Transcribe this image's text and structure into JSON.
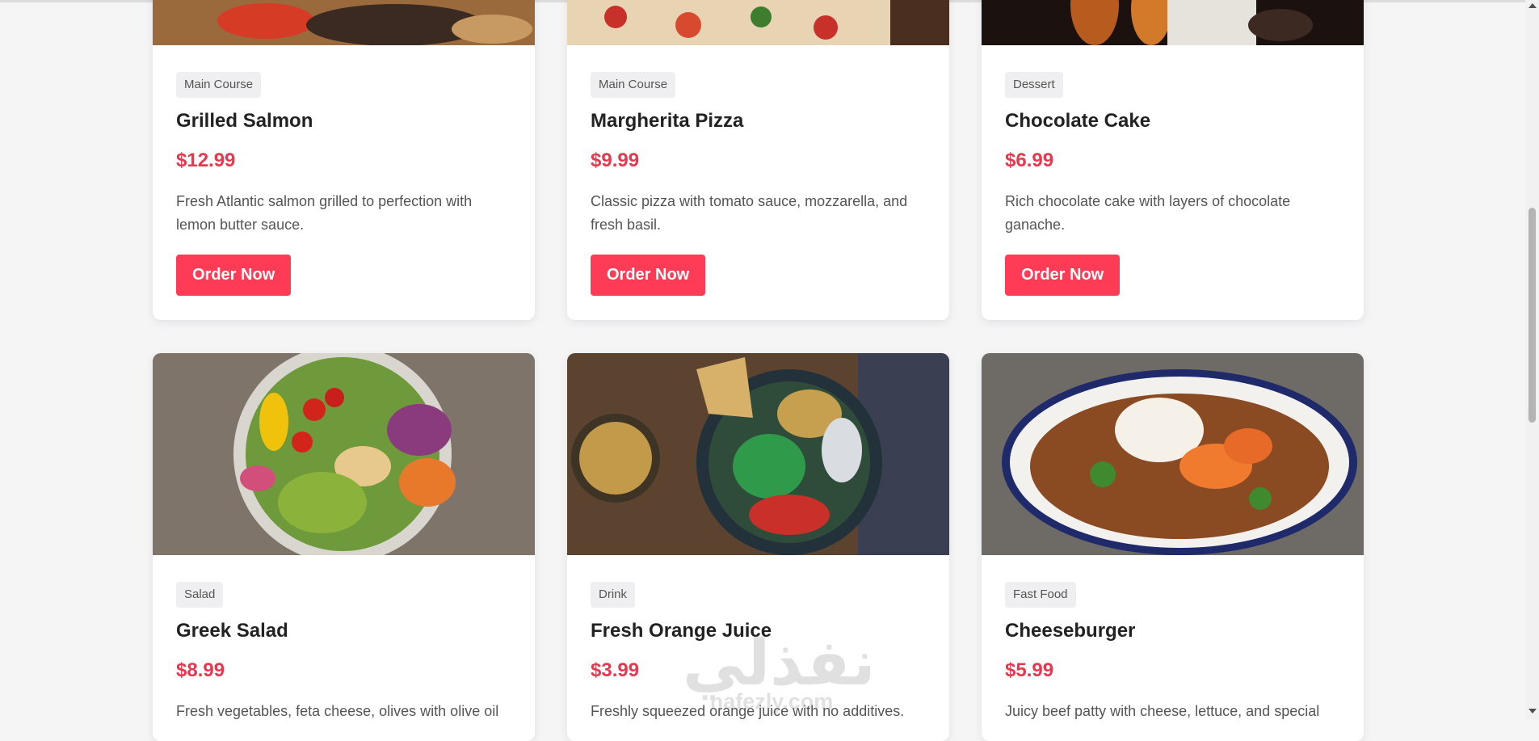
{
  "menu": {
    "top_row": [
      {
        "category": "Main Course",
        "name": "Grilled Salmon",
        "price": "$12.99",
        "description": "Fresh Atlantic salmon grilled to perfection with lemon butter sauce.",
        "button": "Order Now"
      },
      {
        "category": "Main Course",
        "name": "Margherita Pizza",
        "price": "$9.99",
        "description": "Classic pizza with tomato sauce, mozzarella, and fresh basil.",
        "button": "Order Now"
      },
      {
        "category": "Dessert",
        "name": "Chocolate Cake",
        "price": "$6.99",
        "description": "Rich chocolate cake with layers of chocolate ganache.",
        "button": "Order Now"
      }
    ],
    "bottom_row": [
      {
        "category": "Salad",
        "name": "Greek Salad",
        "price": "$8.99",
        "description": "Fresh vegetables, feta cheese, olives with olive oil"
      },
      {
        "category": "Drink",
        "name": "Fresh Orange Juice",
        "price": "$3.99",
        "description": "Freshly squeezed orange juice with no additives."
      },
      {
        "category": "Fast Food",
        "name": "Cheeseburger",
        "price": "$5.99",
        "description": "Juicy beef patty with cheese, lettuce, and special"
      }
    ]
  },
  "watermark": {
    "arabic": "نفذلي",
    "latin": "nafezly.com"
  },
  "colors": {
    "accent": "#ff3b55",
    "price": "#e8384f",
    "badge_bg": "#efeff1",
    "page_bg": "#f5f5f6"
  }
}
